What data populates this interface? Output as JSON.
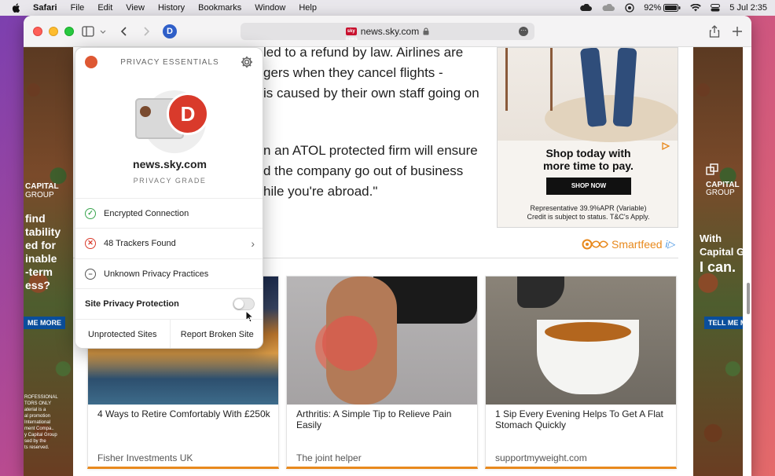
{
  "menubar": {
    "items": [
      "Safari",
      "File",
      "Edit",
      "View",
      "History",
      "Bookmarks",
      "Window",
      "Help"
    ],
    "battery": "92%",
    "datetime": "5 Jul  2:35"
  },
  "browser": {
    "ddg_badge": "D",
    "url": "news.sky.com",
    "favicon_text": "sky news"
  },
  "article": {
    "lines_para1": [
      "led to a refund by law. Airlines are",
      "gers when they cancel flights -",
      "is caused by their own staff going on"
    ],
    "lines_para2": [
      "n an ATOL protected firm will ensure",
      "d the company go out of business",
      "hile you're abroad.\""
    ]
  },
  "display_ad": {
    "headline_1": "Shop today with",
    "headline_2": "more time to pay.",
    "button": "SHOP NOW",
    "fine_1": "Representative 39.9%APR (Variable)",
    "fine_2": "Credit is subject to status. T&C's Apply."
  },
  "smartfeed": {
    "label": "Smartfeed"
  },
  "left_ad": {
    "capital_1": "CAPITAL",
    "capital_2": "GROUP",
    "lines": [
      "find",
      "tability",
      "ed for",
      "inable",
      "-term",
      "ess?"
    ],
    "cta": "ME MORE",
    "disclaimer": [
      "ROFESSIONAL",
      "TORS ONLY",
      "aterial is a",
      "al promotion",
      "International",
      "ment Compa..",
      "y Capital Group",
      "sed by the",
      "ts reserved."
    ]
  },
  "right_ad": {
    "capital_1": "CAPITAL",
    "capital_2": "GROUP",
    "with": "With",
    "capital_gr": "Capital Gr",
    "ican": "I can.",
    "cta": "TELL ME M"
  },
  "cards": [
    {
      "title": "4 Ways to Retire Comfortably With £250k",
      "source": "Fisher Investments UK"
    },
    {
      "title": "Arthritis: A Simple Tip to Relieve Pain Easily",
      "source": "The joint helper"
    },
    {
      "title": "1 Sip Every Evening Helps To Get A Flat Stomach Quickly",
      "source": "supportmyweight.com"
    }
  ],
  "popup": {
    "title": "PRIVACY ESSENTIALS",
    "grade": "D",
    "site": "news.sky.com",
    "grade_label": "PRIVACY GRADE",
    "rows": [
      {
        "label": "Encrypted Connection",
        "status": "ok"
      },
      {
        "label": "48 Trackers Found",
        "status": "bad"
      },
      {
        "label": "Unknown Privacy Practices",
        "status": "neutral"
      }
    ],
    "protection_label": "Site Privacy Protection",
    "protection_on": false,
    "footer_left": "Unprotected Sites",
    "footer_right": "Report Broken Site"
  },
  "colors": {
    "grade_red": "#d93a2b",
    "ok_green": "#3aa54f",
    "smartfeed_orange": "#e8891d",
    "ddg_orange": "#de5833",
    "ddg_blue": "#2f5fc9"
  }
}
